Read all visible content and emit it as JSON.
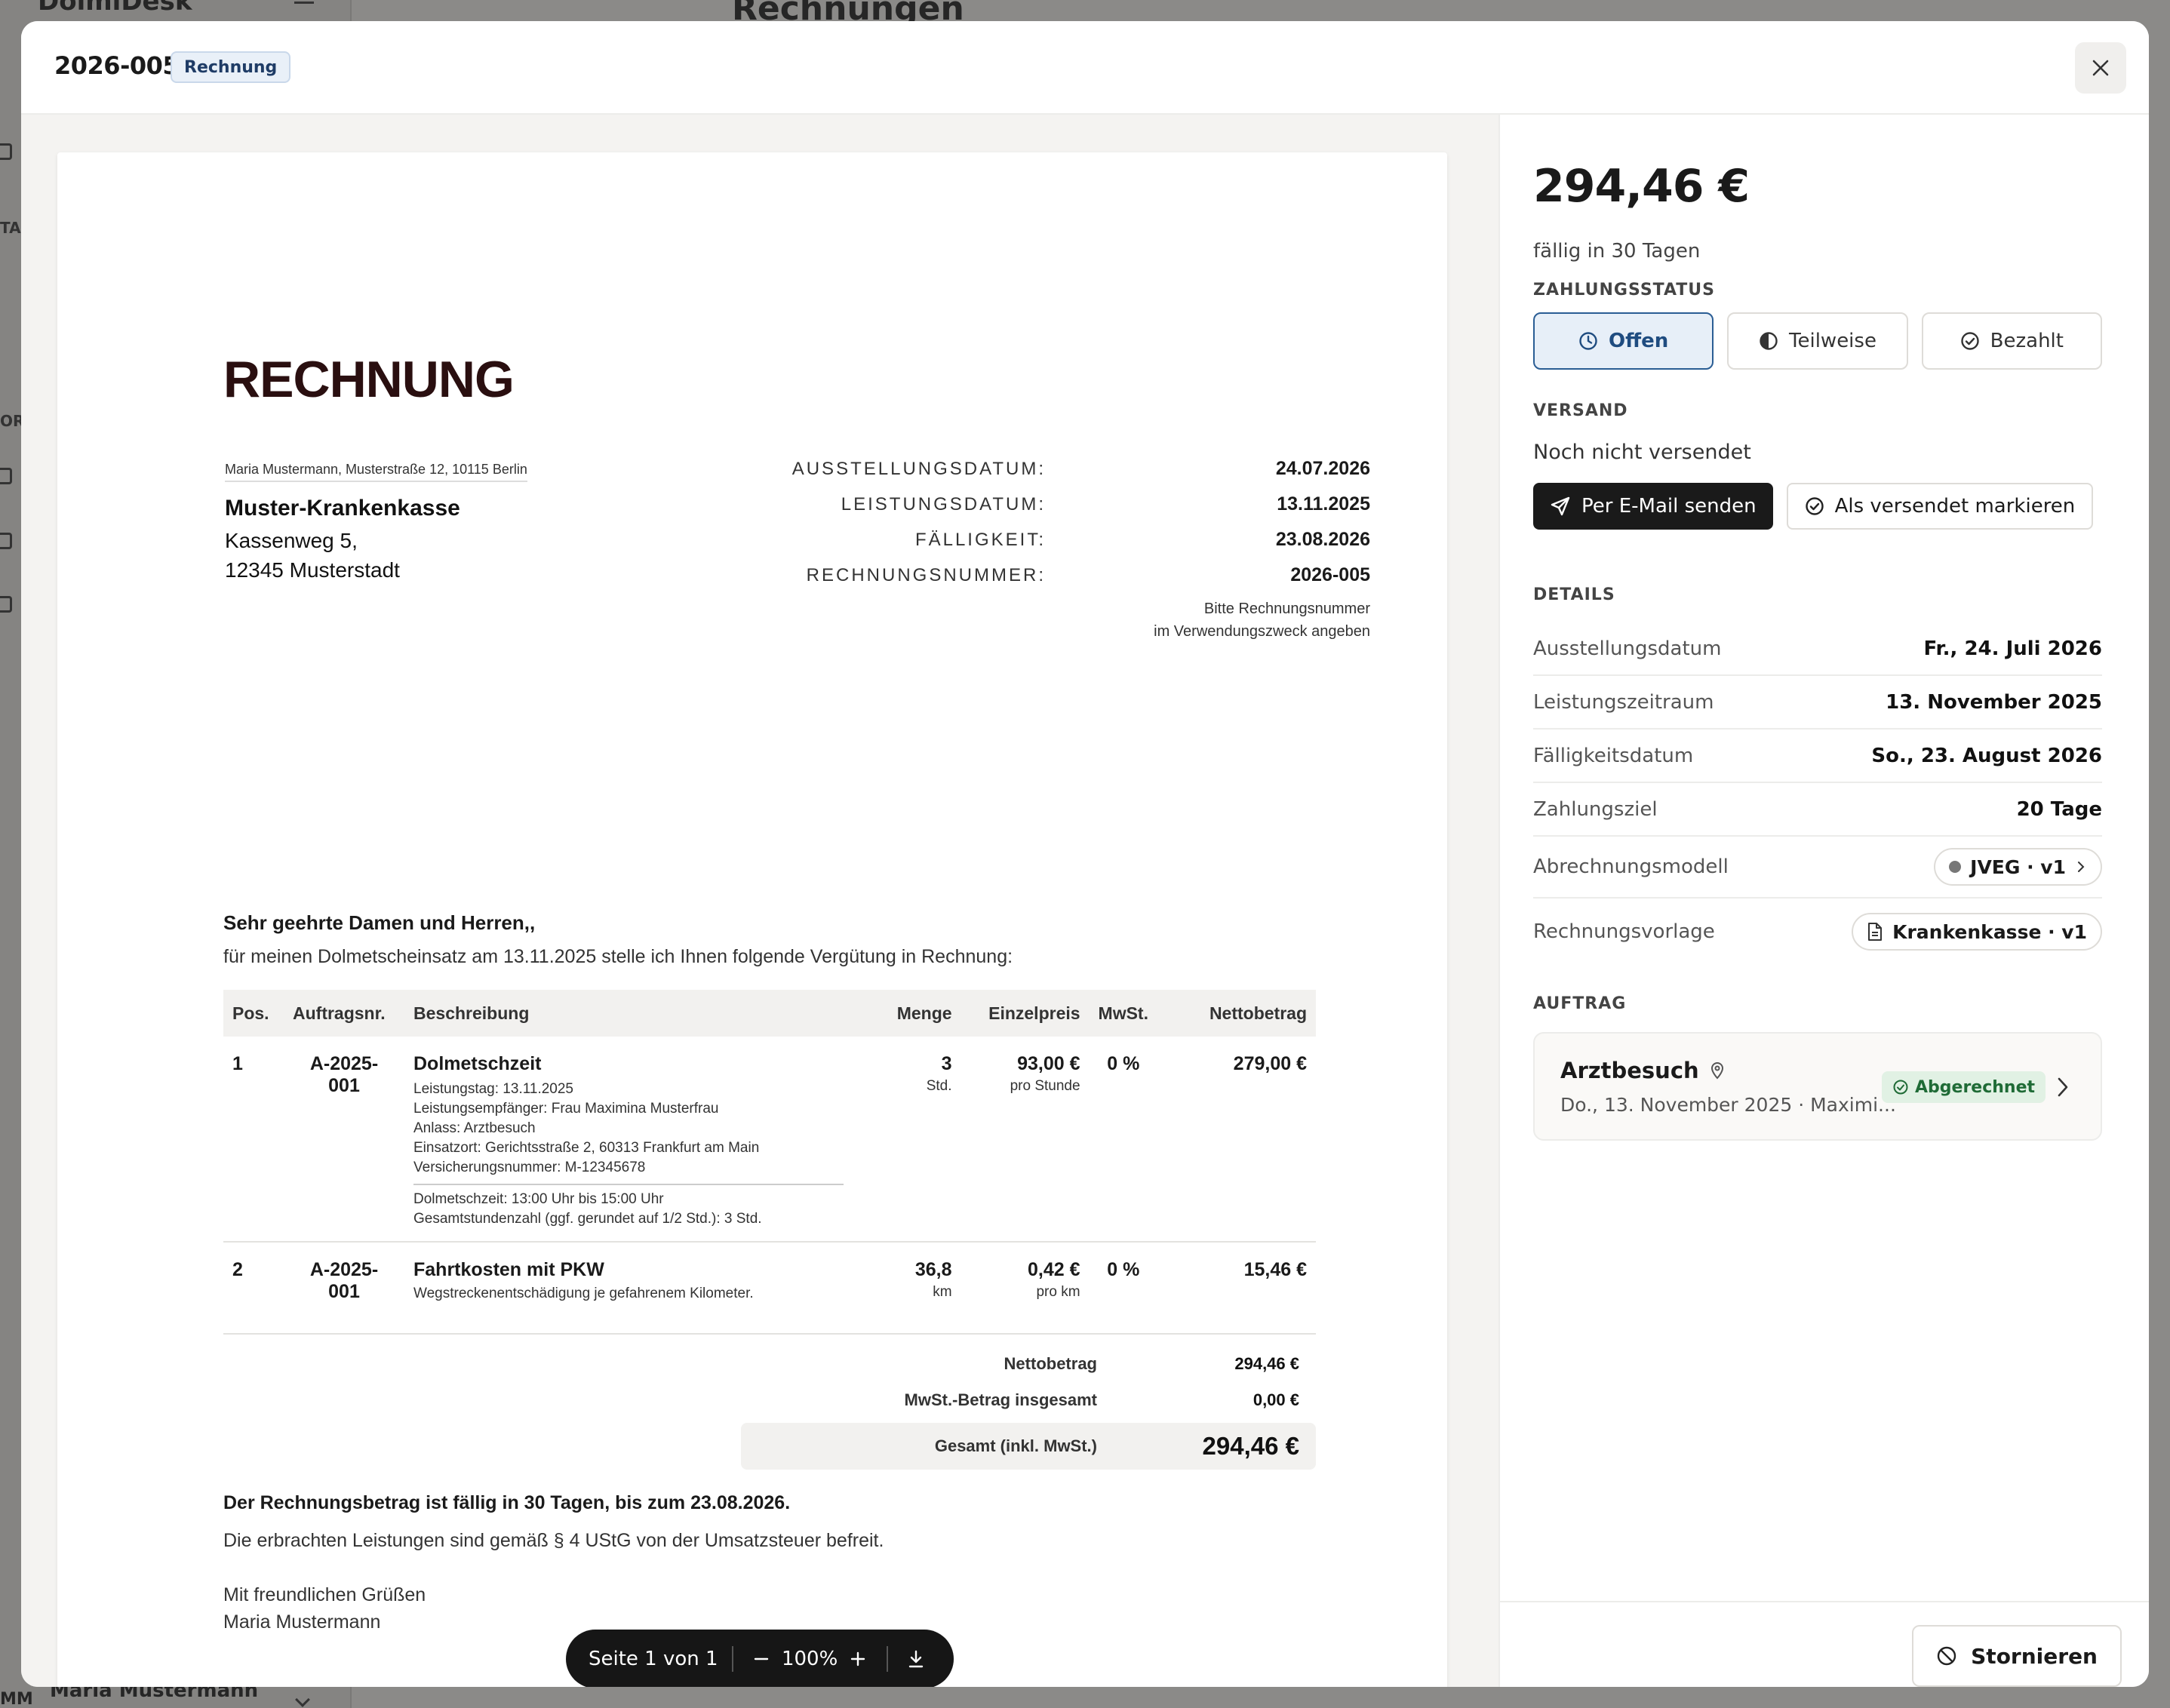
{
  "background": {
    "brand": "DolmiDesk",
    "page_title": "Rechnungen",
    "user_name": "Maria Mustermann",
    "user_initials": "MM",
    "sidebar_label_1": "TA",
    "sidebar_label_2": "OR"
  },
  "modal": {
    "invoice_number": "2026-005",
    "type_badge": "Rechnung"
  },
  "document": {
    "title": "RECHNUNG",
    "sender_line": "Maria Mustermann, Musterstraße 12, 10115 Berlin",
    "recipient": {
      "name": "Muster-Krankenkasse",
      "street": "Kassenweg 5,",
      "city": "12345 Musterstadt"
    },
    "meta": [
      {
        "label": "AUSSTELLUNGSDATUM:",
        "value": "24.07.2026"
      },
      {
        "label": "LEISTUNGSDATUM:",
        "value": "13.11.2025"
      },
      {
        "label": "FÄLLIGKEIT:",
        "value": "23.08.2026"
      },
      {
        "label": "RECHNUNGSNUMMER:",
        "value": "2026-005"
      }
    ],
    "meta_note_1": "Bitte Rechnungsnummer",
    "meta_note_2": "im Verwendungszweck angeben",
    "greeting": "Sehr geehrte Damen und Herren,,",
    "intro": "für meinen Dolmetscheinsatz am 13.11.2025 stelle ich Ihnen folgende Vergütung in Rechnung:",
    "columns": {
      "pos": "Pos.",
      "order": "Auftragsnr.",
      "desc": "Beschreibung",
      "qty": "Menge",
      "unit_price": "Einzelpreis",
      "vat": "MwSt.",
      "net": "Nettobetrag"
    },
    "items": [
      {
        "pos": "1",
        "order_1": "A-2025-",
        "order_2": "001",
        "title": "Dolmetschzeit",
        "lines": [
          "Leistungstag: 13.11.2025",
          "Leistungsempfänger: Frau Maximina Musterfrau",
          "Anlass: Arztbesuch",
          "Einsatzort: Gerichtsstraße 2, 60313 Frankfurt am Main",
          "Versicherungsnummer: M-12345678"
        ],
        "extra_lines": [
          "Dolmetschzeit: 13:00 Uhr bis 15:00 Uhr",
          "Gesamtstundenzahl (ggf. gerundet auf 1/2 Std.): 3 Std."
        ],
        "qty": "3",
        "qty_unit": "Std.",
        "unit_price": "93,00 €",
        "unit_price_unit": "pro Stunde",
        "vat": "0 %",
        "net": "279,00 €"
      },
      {
        "pos": "2",
        "order_1": "A-2025-",
        "order_2": "001",
        "title": "Fahrtkosten mit PKW",
        "lines": [
          "Wegstreckenentschädigung je gefahrenem Kilometer."
        ],
        "qty": "36,8",
        "qty_unit": "km",
        "unit_price": "0,42 €",
        "unit_price_unit": "pro km",
        "vat": "0 %",
        "net": "15,46 €"
      }
    ],
    "totals": {
      "net_label": "Nettobetrag",
      "net_value": "294,46 €",
      "vat_label": "MwSt.-Betrag insgesamt",
      "vat_value": "0,00 €",
      "gross_label": "Gesamt (inkl. MwSt.)",
      "gross_value": "294,46 €"
    },
    "due_note": "Der Rechnungsbetrag ist fällig in 30 Tagen, bis zum 23.08.2026.",
    "vat_note": "Die erbrachten Leistungen sind gemäß § 4 UStG von der Umsatzsteuer befreit.",
    "closing_1": "Mit freundlichen Grüßen",
    "closing_2": "Maria Mustermann"
  },
  "pager": {
    "page_label": "Seite 1 von 1",
    "zoom": "100%"
  },
  "side": {
    "amount": "294,46 €",
    "due": "fällig in 30 Tagen",
    "payment_label": "ZAHLUNGSSTATUS",
    "payment_options": {
      "open": "Offen",
      "partial": "Teilweise",
      "paid": "Bezahlt"
    },
    "shipping_label": "VERSAND",
    "shipping_status": "Noch nicht versendet",
    "send_email": "Per E-Mail senden",
    "mark_sent": "Als versendet markieren",
    "details_label": "DETAILS",
    "details": {
      "issue_label": "Ausstellungsdatum",
      "issue_value": "Fr., 24. Juli 2026",
      "period_label": "Leistungszeitraum",
      "period_value": "13. November 2025",
      "due_label": "Fälligkeitsdatum",
      "due_value": "So., 23. August 2026",
      "terms_label": "Zahlungsziel",
      "terms_value": "20 Tage",
      "model_label": "Abrechnungsmodell",
      "model_value": "JVEG · v1",
      "template_label": "Rechnungsvorlage",
      "template_value": "Krankenkasse · v1"
    },
    "order_label": "AUFTRAG",
    "order": {
      "title": "Arztbesuch",
      "subtitle": "Do., 13. November 2025 · Maximi...",
      "badge": "Abgerechnet"
    },
    "cancel": "Stornieren"
  }
}
